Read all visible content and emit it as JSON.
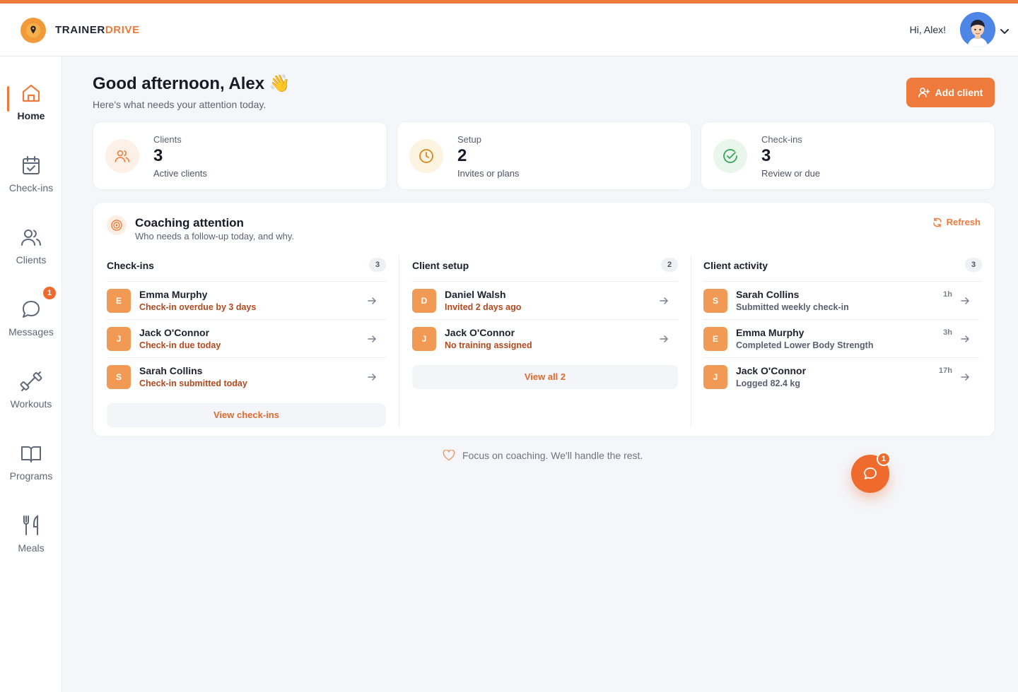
{
  "brand": {
    "part1": "TRAINER",
    "part2": "DRIVE"
  },
  "user": {
    "greeting": "Hi, Alex!"
  },
  "nav": [
    {
      "label": "Home",
      "icon": "home-icon",
      "active": true
    },
    {
      "label": "Check-ins",
      "icon": "calendar-check-icon"
    },
    {
      "label": "Clients",
      "icon": "users-icon"
    },
    {
      "label": "Messages",
      "icon": "chat-icon",
      "badge": "1"
    },
    {
      "label": "Workouts",
      "icon": "dumbbell-icon"
    },
    {
      "label": "Programs",
      "icon": "book-icon"
    },
    {
      "label": "Meals",
      "icon": "utensils-icon"
    }
  ],
  "page": {
    "title": "Good afternoon, Alex 👋",
    "subtitle": "Here's what needs your attention today.",
    "add_client_label": "Add client"
  },
  "stats": [
    {
      "title": "Clients",
      "value": "3",
      "desc": "Active clients",
      "color": "#ee7b3c"
    },
    {
      "title": "Setup",
      "value": "2",
      "desc": "Invites or plans",
      "color": "#d98a1d"
    },
    {
      "title": "Check-ins",
      "value": "3",
      "desc": "Review or due",
      "color": "#3aa35a"
    }
  ],
  "attention": {
    "title": "Coaching attention",
    "subtitle": "Who needs a follow-up today, and why.",
    "refresh_label": "Refresh",
    "columns": [
      {
        "title": "Check-ins",
        "count": "3",
        "rows": [
          {
            "initial": "E",
            "name": "Emma Murphy",
            "desc": "Check-in overdue by 3 days"
          },
          {
            "initial": "J",
            "name": "Jack O'Connor",
            "desc": "Check-in due today"
          },
          {
            "initial": "S",
            "name": "Sarah Collins",
            "desc": "Check-in submitted today"
          }
        ],
        "button": "View check-ins"
      },
      {
        "title": "Client setup",
        "count": "2",
        "rows": [
          {
            "initial": "D",
            "name": "Daniel Walsh",
            "desc": "Invited 2 days ago"
          },
          {
            "initial": "J",
            "name": "Jack O'Connor",
            "desc": "No training assigned"
          }
        ],
        "button": "View all 2"
      },
      {
        "title": "Client activity",
        "count": "3",
        "rows": [
          {
            "initial": "S",
            "name": "Sarah Collins",
            "desc": "Submitted weekly check-in",
            "time": "1h"
          },
          {
            "initial": "E",
            "name": "Emma Murphy",
            "desc": "Completed Lower Body Strength",
            "time": "3h"
          },
          {
            "initial": "J",
            "name": "Jack O'Connor",
            "desc": "Logged 82.4 kg",
            "time": "17h"
          }
        ]
      }
    ]
  },
  "footer_note": "Focus on coaching. We'll handle the rest.",
  "fab_badge": "1",
  "colors": {
    "accent": "#ee7b3c",
    "alert_text": "#b2491f"
  }
}
